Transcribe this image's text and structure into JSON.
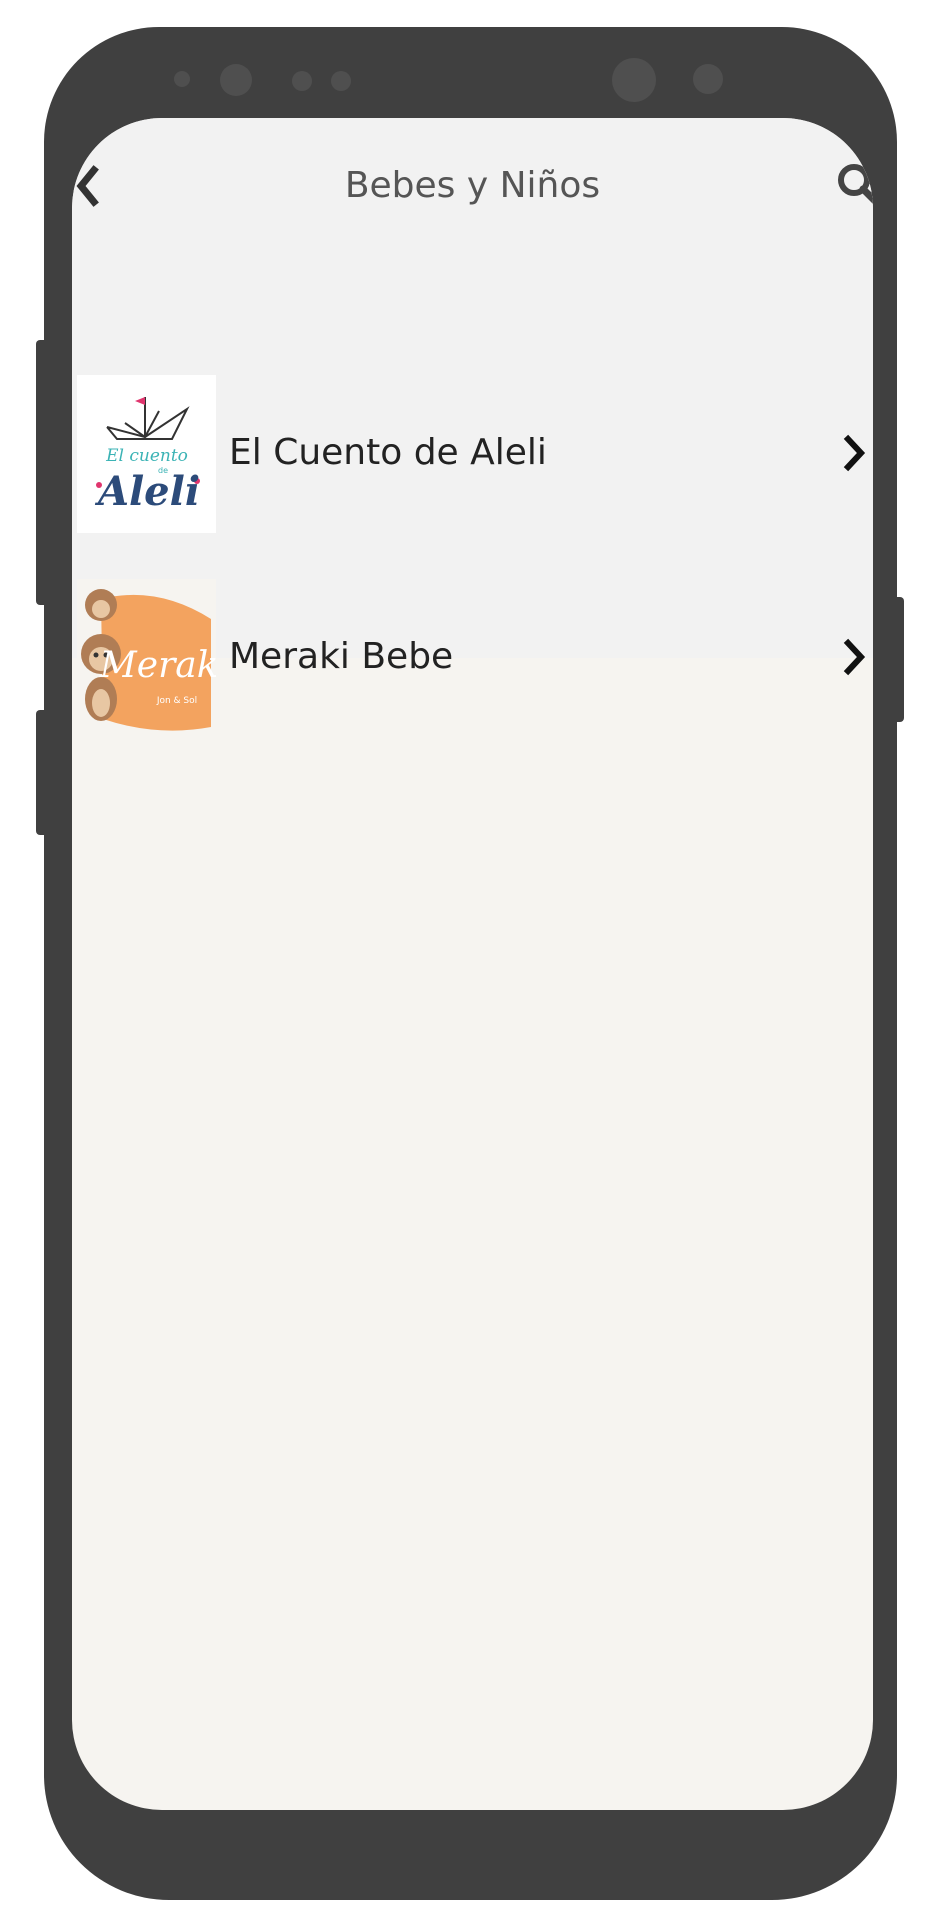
{
  "header": {
    "title": "Bebes y Niños",
    "back_icon": "chevron-left-icon",
    "search_icon": "search-icon"
  },
  "stores": [
    {
      "name": "El Cuento de Aleli",
      "logo_text_top": "El cuento",
      "logo_text_small": "de",
      "logo_text_main": "Aleli",
      "chevron_icon": "chevron-right-icon"
    },
    {
      "name": "Meraki Bebe",
      "logo_text_main": "Meraki",
      "logo_text_small": "Jon & Sol",
      "chevron_icon": "chevron-right-icon"
    }
  ],
  "colors": {
    "device_frame": "#404040",
    "screen_background": "#f6f4f0",
    "list_background": "#f2f2f2",
    "meraki_orange": "#f3a35f",
    "aleli_blue": "#2c4b7a",
    "aleli_teal": "#3bb3b5",
    "aleli_pink": "#e0356e"
  }
}
